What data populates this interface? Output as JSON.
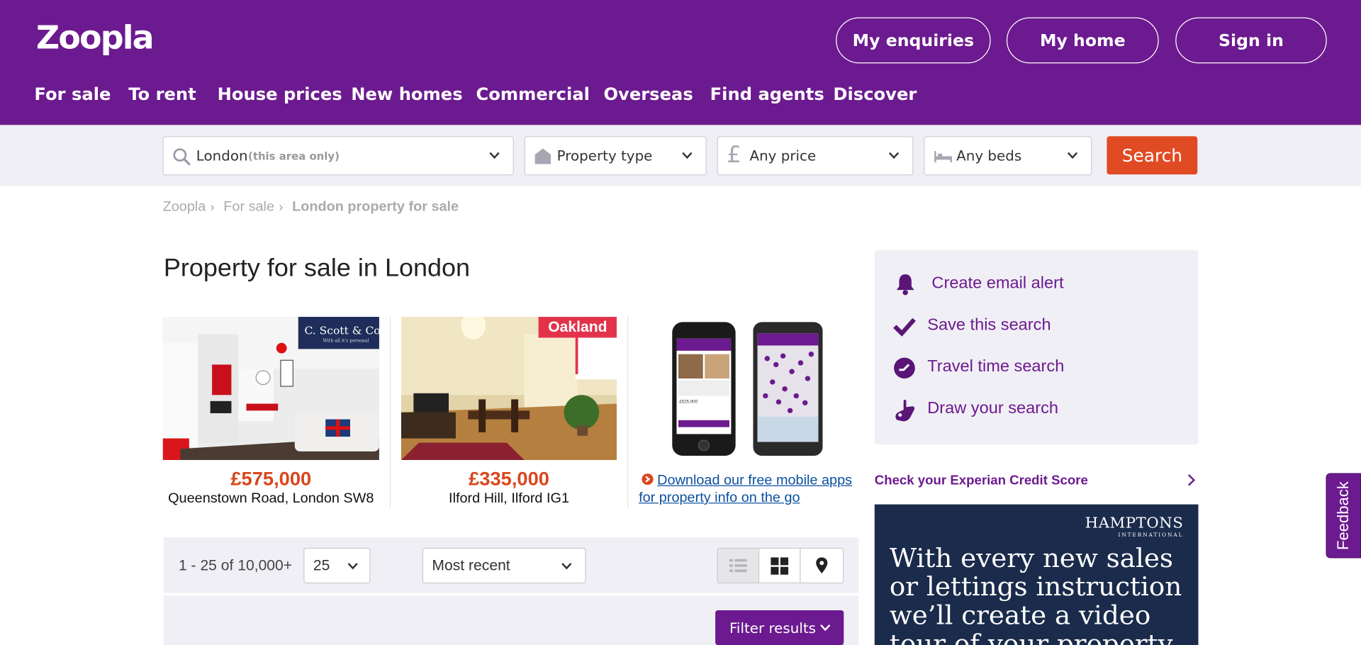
{
  "header": {
    "logo": "Zoopla",
    "buttons": {
      "enquiries": "My enquiries",
      "home": "My home",
      "signin": "Sign in"
    },
    "nav": [
      "For sale",
      "To rent",
      "House prices",
      "New homes",
      "Commercial",
      "Overseas",
      "Find agents",
      "Discover"
    ],
    "brand_color": "#6c1a8f"
  },
  "search": {
    "location_value": "London",
    "location_hint": "(this area only)",
    "property_type": "Property type",
    "price": "Any price",
    "beds": "Any beds",
    "button": "Search",
    "button_color": "#e04b24"
  },
  "breadcrumb": [
    "Zoopla",
    "For sale",
    "London property for sale"
  ],
  "page_title": "Property for sale in London",
  "featured": [
    {
      "agent": "C. Scott & Co",
      "agent_tagline": "With all it's personal",
      "price": "£575,000",
      "address": "Queenstown Road, London SW8"
    },
    {
      "agent": "Oakland",
      "price": "£335,000",
      "address": "Ilford Hill, Ilford IG1"
    }
  ],
  "app_promo": {
    "link": "Download our free mobile apps for property info on the go",
    "phone1_price": "£525,000"
  },
  "toolbar": {
    "results": "1 - 25 of 10,000+",
    "per_page": "25",
    "sort": "Most recent",
    "filter_button": "Filter results"
  },
  "sidebar": {
    "items": [
      "Create email alert",
      "Save this search",
      "Travel time search",
      "Draw your search"
    ],
    "experian": "Check your Experian Credit Score"
  },
  "ad": {
    "brand": "HAMPTONS",
    "brand_sub": "INTERNATIONAL",
    "text": "With every new sales or lettings instruction we’ll create a video tour of your property"
  },
  "feedback": "Feedback"
}
